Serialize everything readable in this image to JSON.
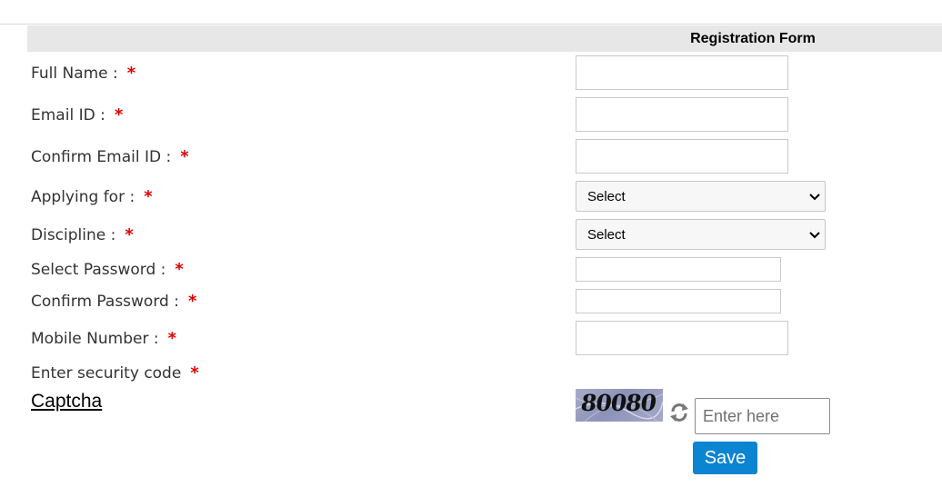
{
  "form": {
    "title": "Registration Form",
    "required_marker": "*",
    "labels": {
      "full_name": "Full Name :",
      "email": "Email ID :",
      "confirm_email": "Confirm Email ID :",
      "applying_for": "Applying for :",
      "discipline": "Discipline :",
      "select_password": "Select Password :",
      "confirm_password": "Confirm Password :",
      "mobile": "Mobile Number :",
      "security_code": "Enter security code"
    },
    "values": {
      "full_name": "",
      "email": "",
      "confirm_email": "",
      "select_password": "",
      "confirm_password": "",
      "mobile": "",
      "captcha_input": ""
    },
    "applying_for_selected": "Select",
    "discipline_selected": "Select"
  },
  "captcha": {
    "link_label": "Captcha",
    "image_text": "80080",
    "input_placeholder": "Enter here",
    "refresh_icon": "refresh-icon"
  },
  "actions": {
    "save_label": "Save"
  },
  "colors": {
    "header_bg": "#e7e7e7",
    "required": "#e00000",
    "save_button": "#0b84d1"
  }
}
